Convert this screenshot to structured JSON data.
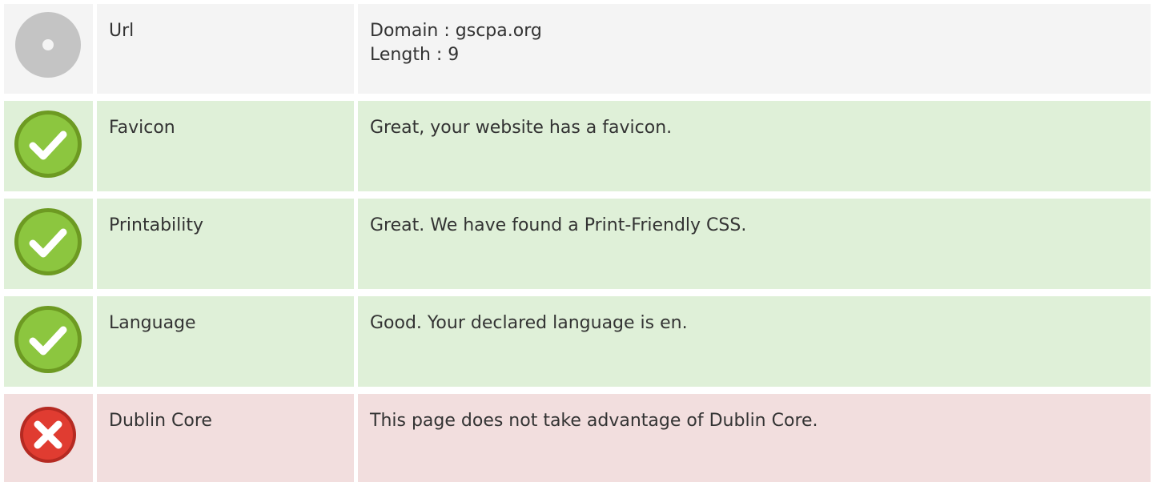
{
  "rows": [
    {
      "status": "neutral",
      "icon": "neutral-disc-icon",
      "name": "Url",
      "lines": [
        "Domain : gscpa.org",
        "Length : 9"
      ]
    },
    {
      "status": "pass",
      "icon": "green-check-icon",
      "name": "Favicon",
      "lines": [
        "Great, your website has a favicon."
      ]
    },
    {
      "status": "pass",
      "icon": "green-check-icon",
      "name": "Printability",
      "lines": [
        "Great. We have found a Print-Friendly CSS."
      ]
    },
    {
      "status": "pass",
      "icon": "green-check-icon",
      "name": "Language",
      "lines": [
        "Good. Your declared language is en."
      ]
    },
    {
      "status": "fail",
      "icon": "red-cross-icon",
      "name": "Dublin Core",
      "lines": [
        "This page does not take advantage of Dublin Core."
      ]
    }
  ],
  "colors": {
    "pass_bg": "#dff0d8",
    "fail_bg": "#f2dede",
    "neutral_bg": "#f4f4f4",
    "check_green": "#8cc63f",
    "cross_red": "#e03c31"
  }
}
